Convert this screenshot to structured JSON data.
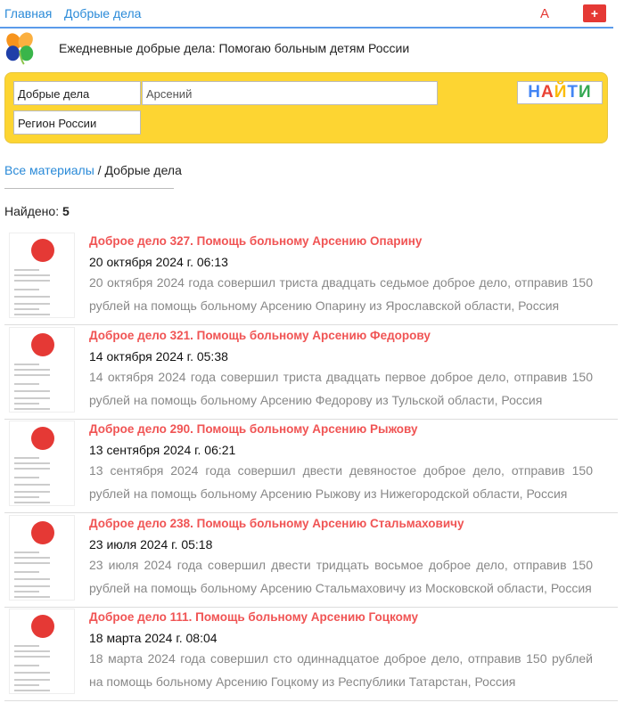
{
  "nav": {
    "home": "Главная",
    "good_deeds": "Добрые дела",
    "font_toggle": "A",
    "add": "+"
  },
  "tagline": "Ежедневные добрые дела: Помогаю больным детям России",
  "search": {
    "category": "Добрые дела",
    "query": "Арсений",
    "region": "Регион России",
    "button": [
      "Н",
      "А",
      "Й",
      "Т",
      "И"
    ],
    "button_colors": [
      "#4285f4",
      "#ea4335",
      "#fbbc05",
      "#4285f4",
      "#34a853"
    ]
  },
  "breadcrumb": {
    "all": "Все материалы",
    "sep": " / ",
    "current": "Добрые дела"
  },
  "found": {
    "label": "Найдено: ",
    "count": "5"
  },
  "items": [
    {
      "title": "Доброе дело 327. Помощь больному Арсению Опарину",
      "date": "20 октября 2024 г. 06:13",
      "desc": "20 октября 2024 года совершил триста двадцать седьмое доброе дело, отправив 150 рублей на помощь больному Арсению Опарину из Ярославской области, Россия"
    },
    {
      "title": "Доброе дело 321. Помощь больному Арсению Федорову",
      "date": "14 октября 2024 г. 05:38",
      "desc": "14 октября 2024 года совершил триста двадцать первое доброе дело, отправив 150 рублей на помощь больному Арсению Федорову из Тульской области, Россия"
    },
    {
      "title": "Доброе дело 290. Помощь больному Арсению Рыжову",
      "date": "13 сентября 2024 г. 06:21",
      "desc": "13 сентября 2024 года совершил двести девяностое доброе дело, отправив 150 рублей на помощь больному Арсению Рыжову из Нижегородской области, Россия"
    },
    {
      "title": "Доброе дело 238. Помощь больному Арсению Стальмаховичу",
      "date": "23 июля 2024 г. 05:18",
      "desc": "23 июля 2024 года совершил двести тридцать восьмое доброе дело, отправив 150 рублей на помощь больному Арсению Стальмаховичу из Московской области, Россия"
    },
    {
      "title": "Доброе дело 111. Помощь больному Арсению Гоцкому",
      "date": "18 марта 2024 г. 08:04",
      "desc": "18 марта 2024 года совершил сто одиннадцатое доброе дело, отправив 150 рублей на помощь больному Арсению Гоцкому из Республики Татарстан, Россия"
    }
  ]
}
